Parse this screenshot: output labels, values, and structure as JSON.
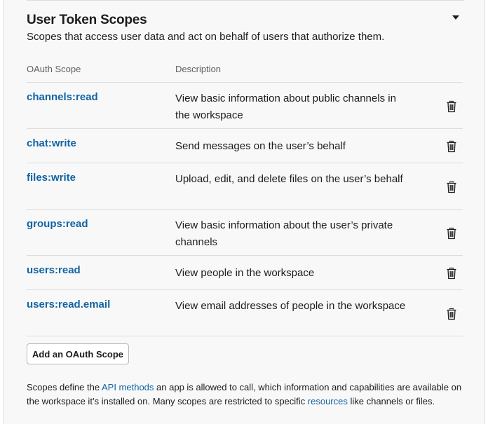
{
  "section": {
    "title": "User Token Scopes",
    "subtitle": "Scopes that access user data and act on behalf of users that authorize them."
  },
  "table": {
    "headers": {
      "scope": "OAuth Scope",
      "description": "Description"
    },
    "rows": [
      {
        "scope": "channels:read",
        "description": "View basic information about public channels in the workspace"
      },
      {
        "scope": "chat:write",
        "description": "Send messages on the user’s behalf"
      },
      {
        "scope": "files:write",
        "description": "Upload, edit, and delete files on the user’s behalf"
      },
      {
        "scope": "groups:read",
        "description": "View basic information about the user’s private channels"
      },
      {
        "scope": "users:read",
        "description": "View people in the workspace"
      },
      {
        "scope": "users:read.email",
        "description": "View email addresses of people in the workspace"
      }
    ]
  },
  "add_button": {
    "label": "Add an OAuth Scope"
  },
  "footer": {
    "part1": "Scopes define the ",
    "link1": "API methods",
    "part2": " an app is allowed to call, which information and capabilities are available on the workspace it’s installed on. Many scopes are restricted to specific ",
    "link2": "resources",
    "part3": " like channels or files."
  },
  "icons": {
    "delete": "trash-icon",
    "collapse": "caret-down-icon"
  },
  "colors": {
    "link": "#1264a3",
    "text": "#1d1c1d",
    "muted": "#616061",
    "divider": "#dddddd",
    "panel": "#f8f8f8"
  }
}
